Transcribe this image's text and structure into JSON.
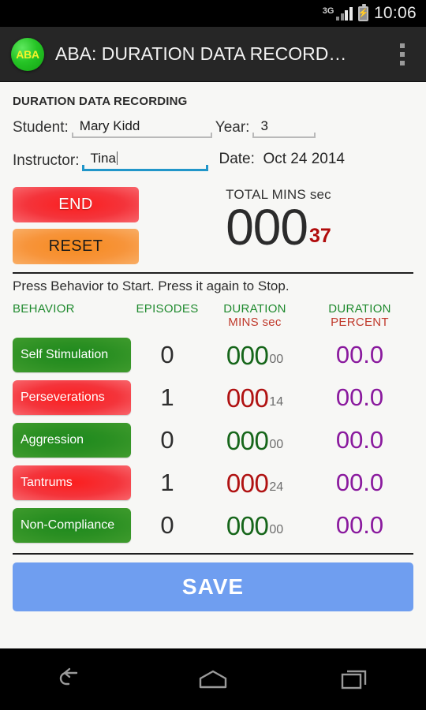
{
  "status_bar": {
    "network": "3G",
    "time": "10:06",
    "battery_icon": "battery-charging-icon",
    "signal_icon": "signal-bars-icon"
  },
  "action_bar": {
    "app_logo_text": "ABA",
    "title": "ABA: DURATION DATA RECORD…",
    "overflow_icon": "overflow-menu-icon"
  },
  "form": {
    "section_title": "DURATION DATA RECORDING",
    "student_label": "Student:",
    "student_value": "Mary Kidd",
    "year_label": "Year:",
    "year_value": "3",
    "instructor_label": "Instructor:",
    "instructor_value": "Tina",
    "date_label": "Date:",
    "date_value": "Oct 24 2014"
  },
  "controls": {
    "end_label": "END",
    "reset_label": "RESET",
    "total_label": "TOTAL MINS sec",
    "total_minutes": "000",
    "total_seconds": "37",
    "hint": "Press Behavior to Start. Press it again to Stop."
  },
  "table": {
    "headers": {
      "behavior": "BEHAVIOR",
      "episodes": "EPISODES",
      "duration": "DURATION",
      "duration_sub": "MINS sec",
      "percent": "DURATION",
      "percent_sub": "PERCENT"
    },
    "rows": [
      {
        "behavior": "Self Stimulation",
        "color": "green",
        "episodes": "0",
        "duration_minutes": "000",
        "duration_seconds": "00",
        "percent": "00.0"
      },
      {
        "behavior": "Perseverations",
        "color": "red",
        "episodes": "1",
        "duration_minutes": "000",
        "duration_seconds": "14",
        "percent": "00.0"
      },
      {
        "behavior": "Aggression",
        "color": "green",
        "episodes": "0",
        "duration_minutes": "000",
        "duration_seconds": "00",
        "percent": "00.0"
      },
      {
        "behavior": "Tantrums",
        "color": "red",
        "episodes": "1",
        "duration_minutes": "000",
        "duration_seconds": "24",
        "percent": "00.0"
      },
      {
        "behavior": "Non-Compliance",
        "color": "green",
        "episodes": "0",
        "duration_minutes": "000",
        "duration_seconds": "00",
        "percent": "00.0"
      }
    ]
  },
  "save": {
    "label": "SAVE"
  },
  "nav_bar": {
    "back_icon": "back-arrow-icon",
    "home_icon": "home-icon",
    "recents_icon": "recent-apps-icon"
  },
  "colors": {
    "green_header": "#1f8a2e",
    "red_sub": "#c0392b",
    "purple_percent": "#8a1a9e",
    "save_blue": "#6f9ef0",
    "focus_blue": "#2196c9"
  }
}
